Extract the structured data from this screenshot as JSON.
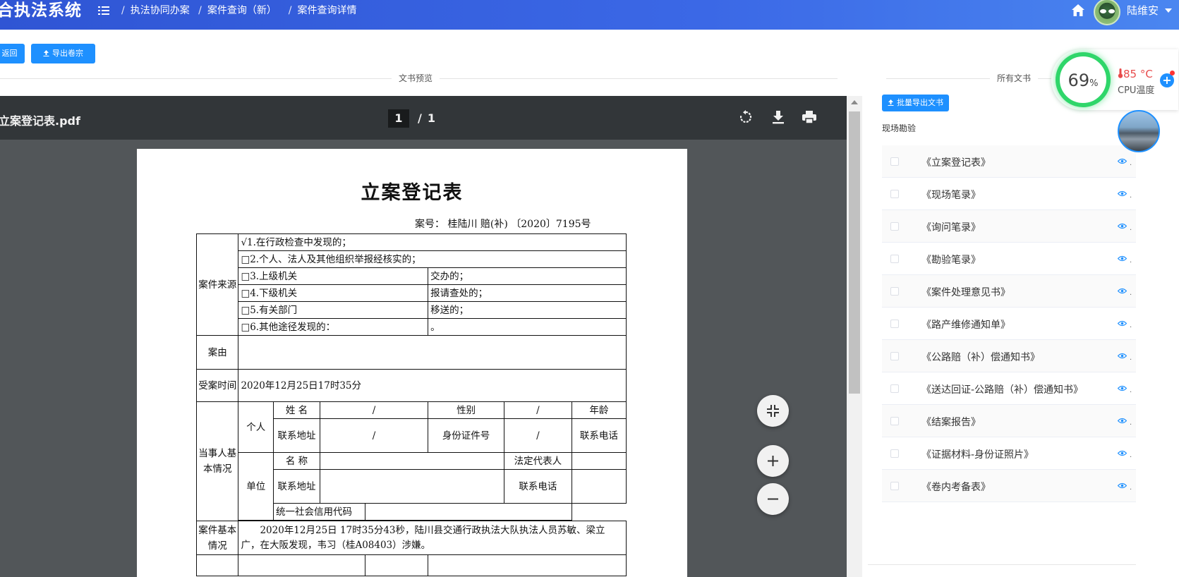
{
  "header": {
    "logo": "合执法系统",
    "breadcrumb": [
      "执法协同办案",
      "案件查询（新）",
      "案件查询详情"
    ],
    "user_name": "陆维安"
  },
  "toolbar": {
    "back_label": "返回",
    "export_label": "导出卷宗"
  },
  "preview": {
    "section_title": "文书预览",
    "file_name": "立案登记表.pdf",
    "current_page": "1",
    "page_separator": "/",
    "total_pages": "1"
  },
  "document": {
    "title": "立案登记表",
    "case_no": "案号： 桂陆川 赔(补) 〔2020〕7195号",
    "source_label": "案件来源",
    "sources": [
      "√1.在行政检查中发现的；",
      "□2.个人、法人及其他组织举报经核实的；",
      "□3.上级机关",
      "□4.下级机关",
      "□5.有关部门",
      "□6.其他途径发现的："
    ],
    "source_suffix": [
      "交办的；",
      "报请查处的；",
      "移送的；",
      "。"
    ],
    "reason_label": "案由",
    "accept_time_label": "受案时间",
    "accept_time": "2020年12月25日17时35分",
    "party_label": "当事人基本情况",
    "person_label": "个人",
    "name_label": "姓 名",
    "gender_label": "性别",
    "age_label": "年龄",
    "address_label": "联系地址",
    "id_label": "身份证件号",
    "phone_label": "联系电话",
    "slash": "/",
    "unit_label": "单位",
    "unit_name_label": "名 称",
    "legal_rep_label": "法定代表人",
    "credit_code_label": "统一社会信用代码",
    "summary_label": "案件基本情况",
    "summary": "2020年12月25日 17时35分43秒，陆川县交通行政执法大队执法人员苏敏、梁立广，在大阪发现，韦习（桂A08403）涉嫌。"
  },
  "right_panel": {
    "section_title": "所有文书",
    "batch_export_label": "批量导出文书",
    "group_label": "现场勘验",
    "items": [
      "《立案登记表》",
      "《现场笔录》",
      "《询问笔录》",
      "《勘验笔录》",
      "《案件处理意见书》",
      "《路产维修通知单》",
      "《公路赔（补）偿通知书》",
      "《送达回证-公路赔（补）偿通知书》",
      "《结案报告》",
      "《证据材料-身份证照片》",
      "《卷内考备表》"
    ],
    "item_suffix": "."
  },
  "cpu_widget": {
    "percent": "69",
    "percent_unit": "%",
    "temperature": "85 °C",
    "label": "CPU温度"
  },
  "colors": {
    "header_bg": "#3b68e6",
    "primary": "#1e90ff",
    "viewer_bg": "#525659",
    "viewer_toolbar": "#323639",
    "gauge_ring": "#2fd66a",
    "temp_red": "#e84b4b"
  },
  "icons": [
    "menu-icon",
    "home-icon",
    "rotate-icon",
    "download-icon",
    "print-icon",
    "fit-icon",
    "zoom-in-icon",
    "zoom-out-icon",
    "eye-icon",
    "upload-icon",
    "thermometer-icon",
    "plus-icon"
  ]
}
